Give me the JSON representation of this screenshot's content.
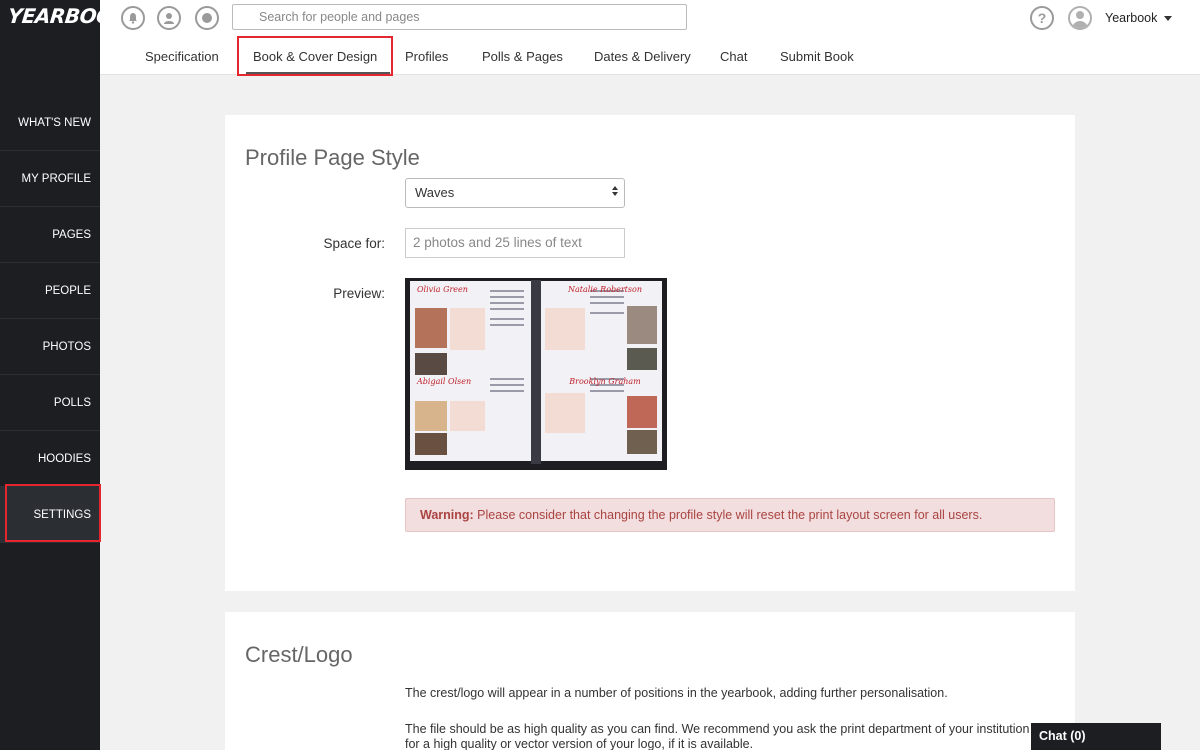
{
  "app": {
    "logo": "YEARBOOK"
  },
  "sidebar": {
    "items": [
      {
        "label": "WHAT'S NEW"
      },
      {
        "label": "MY PROFILE"
      },
      {
        "label": "PAGES"
      },
      {
        "label": "PEOPLE"
      },
      {
        "label": "PHOTOS"
      },
      {
        "label": "POLLS"
      },
      {
        "label": "HOODIES"
      },
      {
        "label": "SETTINGS"
      }
    ],
    "active": "SETTINGS"
  },
  "topbar": {
    "icons": [
      "bell-icon",
      "profile-icon",
      "chat-bubble-icon"
    ],
    "search_placeholder": "Search for people and pages",
    "help_glyph": "?",
    "user_name": "Yearbook"
  },
  "tabs": {
    "items": [
      {
        "label": "Specification"
      },
      {
        "label": "Book & Cover Design"
      },
      {
        "label": "Profiles"
      },
      {
        "label": "Polls & Pages"
      },
      {
        "label": "Dates & Delivery"
      },
      {
        "label": "Chat"
      },
      {
        "label": "Submit Book"
      }
    ],
    "active": "Book & Cover Design"
  },
  "profile_style": {
    "title": "Profile Page Style",
    "style_value": "Waves",
    "space_label": "Space for:",
    "space_value": "2 photos and 25 lines of text",
    "preview_label": "Preview:",
    "preview_names": [
      "Olivia Green",
      "Natalie Robertson",
      "Abigail Olsen",
      "Brooklyn Graham"
    ],
    "warning_strong": "Warning:",
    "warning_text": " Please consider that changing the profile style will reset the print layout screen for all users."
  },
  "crest": {
    "title": "Crest/Logo",
    "para1": "The crest/logo will appear in a number of positions in the yearbook, adding further personalisation.",
    "para2": "The file should be as high quality as you can find. We recommend you ask the print department of your institution for a high quality or vector version of your logo, if it is available."
  },
  "chat": {
    "label": "Chat (0)"
  },
  "colors": {
    "sidebar_bg": "#1c1e22",
    "highlight": "#e3262f",
    "warning_bg": "#f2dede",
    "warning_text": "#a94442",
    "page_bg": "#f1f1f1"
  }
}
